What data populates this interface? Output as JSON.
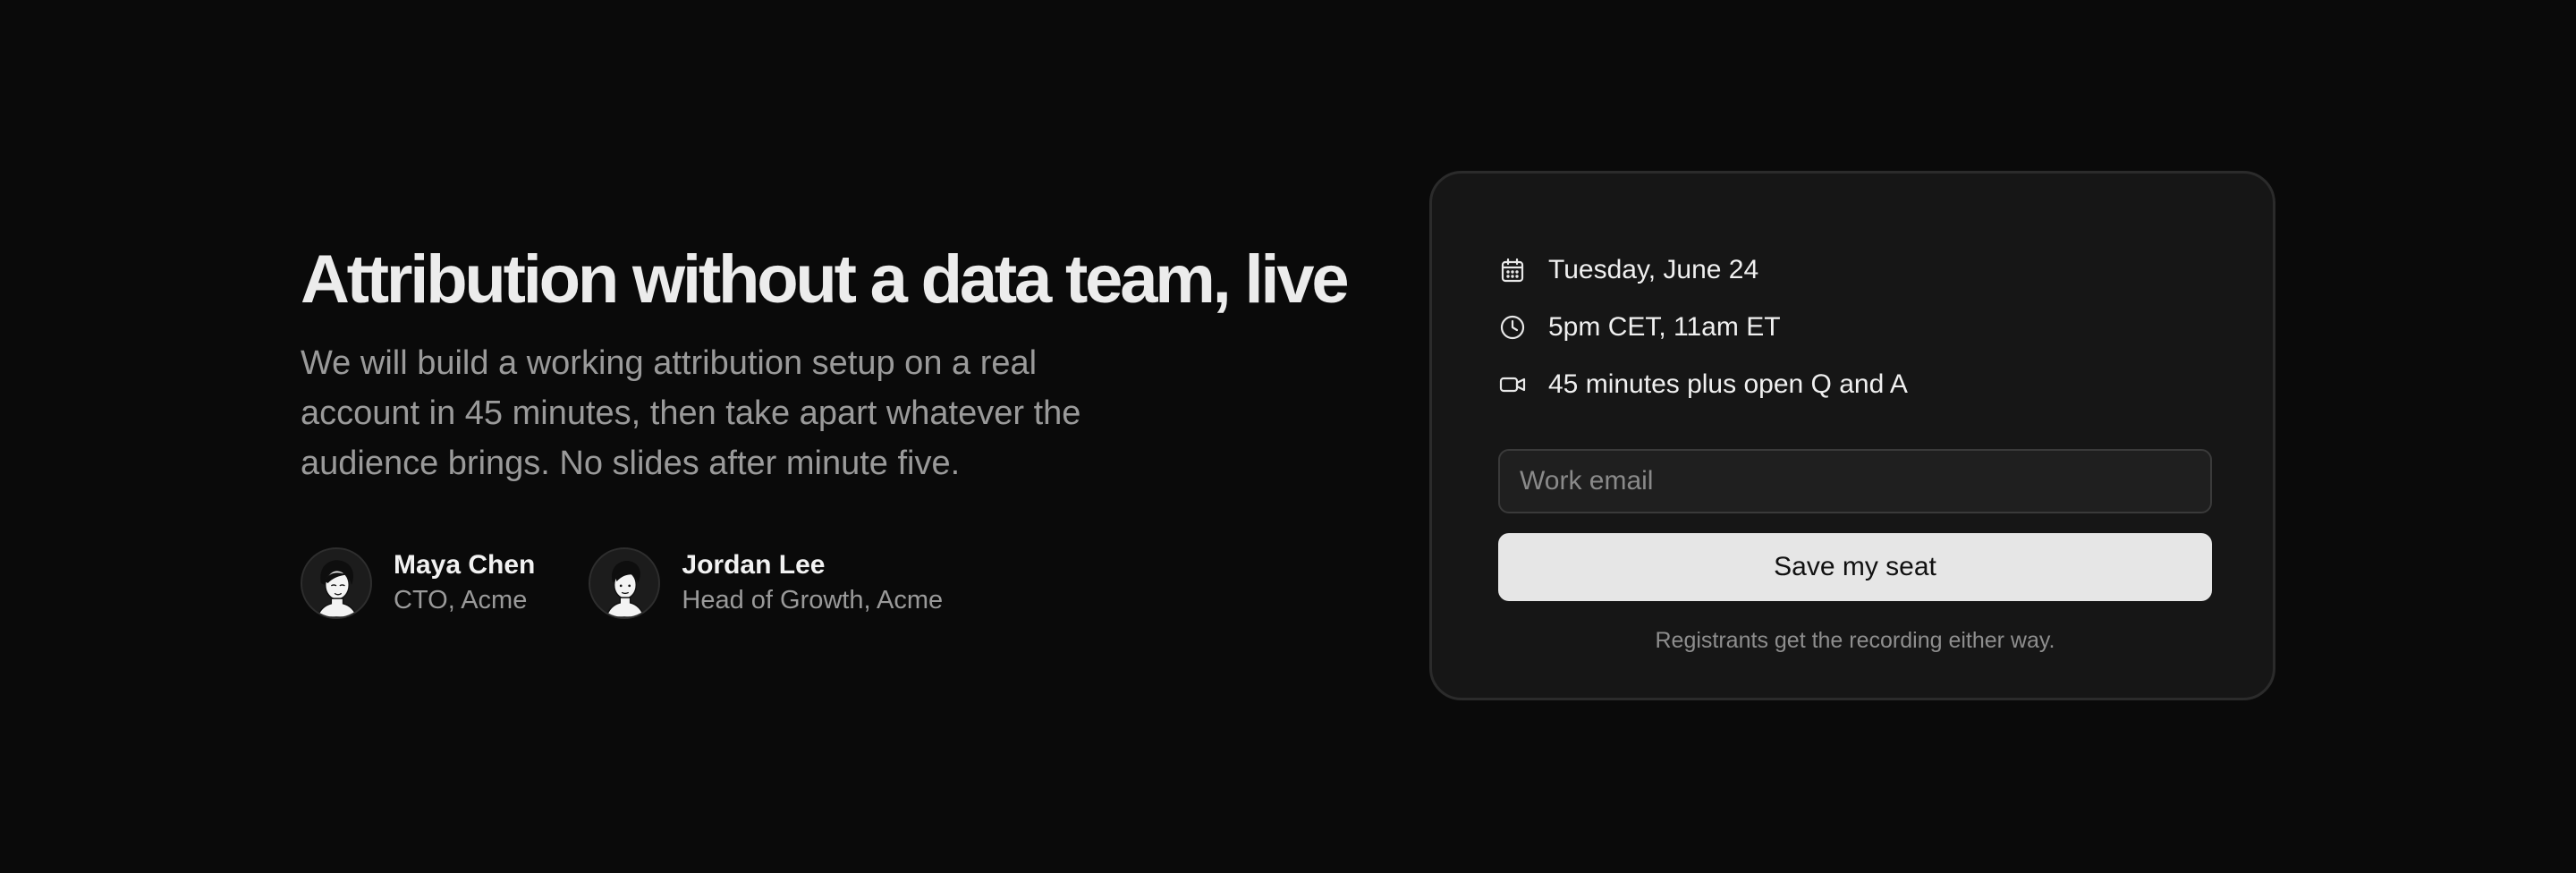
{
  "hero": {
    "title": "Attribution without a data team, live",
    "description": "We will build a working attribution setup on a real account in 45 minutes, then take apart whatever the audience brings. No slides after minute five."
  },
  "speakers": [
    {
      "name": "Maya Chen",
      "role": "CTO, Acme",
      "avatar_icon": "avatar-maya-illustration"
    },
    {
      "name": "Jordan Lee",
      "role": "Head of Growth, Acme",
      "avatar_icon": "avatar-jordan-illustration"
    }
  ],
  "registration": {
    "details": [
      {
        "icon": "calendar-icon",
        "text": "Tuesday, June 24"
      },
      {
        "icon": "clock-icon",
        "text": "5pm CET, 11am ET"
      },
      {
        "icon": "video-icon",
        "text": "45 minutes plus open Q and A"
      }
    ],
    "email_placeholder": "Work email",
    "email_value": "",
    "button_label": "Save my seat",
    "footnote": "Registrants get the recording either way."
  },
  "colors": {
    "background": "#0a0a0a",
    "card": "#161616",
    "button": "#e6e6e6",
    "muted_text": "#9a9a9a"
  }
}
